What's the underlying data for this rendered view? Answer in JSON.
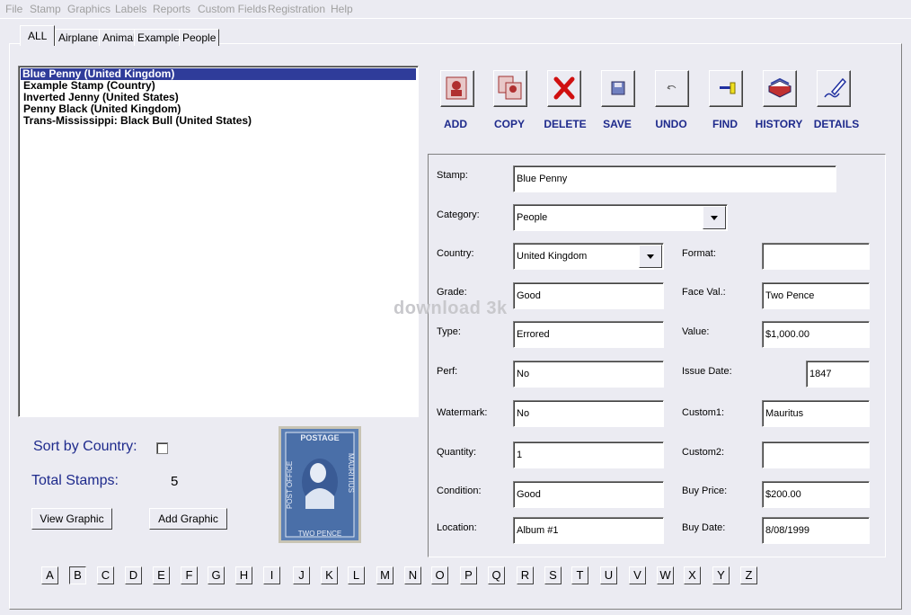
{
  "menu": [
    "File",
    "Stamp",
    "Graphics",
    "Labels",
    "Reports",
    "Custom Fields",
    "Registration",
    "Help"
  ],
  "tabs": [
    "ALL",
    "Airplane",
    "Animal",
    "Example",
    "People"
  ],
  "stamp_list": [
    "Blue Penny (United Kingdom)",
    "Example Stamp (Country)",
    "Inverted Jenny (United States)",
    "Penny Black (United Kingdom)",
    "Trans-Mississippi: Black Bull (United States)"
  ],
  "toolbar": {
    "add": "ADD",
    "copy": "COPY",
    "delete": "DELETE",
    "save": "SAVE",
    "undo": "UNDO",
    "find": "FIND",
    "history": "HISTORY",
    "details": "DETAILS"
  },
  "form": {
    "stamp": {
      "label": "Stamp:",
      "value": "Blue Penny"
    },
    "category": {
      "label": "Category:",
      "value": "People"
    },
    "country": {
      "label": "Country:",
      "value": "United Kingdom"
    },
    "format": {
      "label": "Format:",
      "value": ""
    },
    "grade": {
      "label": "Grade:",
      "value": "Good"
    },
    "face_val": {
      "label": "Face Val.:",
      "value": "Two Pence"
    },
    "type": {
      "label": "Type:",
      "value": "Errored"
    },
    "value": {
      "label": "Value:",
      "value": "$1,000.00"
    },
    "perf": {
      "label": "Perf:",
      "value": "No"
    },
    "issue_date": {
      "label": "Issue Date:",
      "value": "1847"
    },
    "watermark": {
      "label": "Watermark:",
      "value": "No"
    },
    "custom1": {
      "label": "Custom1:",
      "value": "Mauritus"
    },
    "quantity": {
      "label": "Quantity:",
      "value": "1"
    },
    "custom2": {
      "label": "Custom2:",
      "value": ""
    },
    "condition": {
      "label": "Condition:",
      "value": "Good"
    },
    "buy_price": {
      "label": "Buy Price:",
      "value": "$200.00"
    },
    "location": {
      "label": "Location:",
      "value": "Album #1"
    },
    "buy_date": {
      "label": "Buy Date:",
      "value": "8/08/1999"
    }
  },
  "sort_by_country": {
    "label": "Sort by Country:",
    "checked": false
  },
  "total_stamps": {
    "label": "Total Stamps:",
    "value": "5"
  },
  "buttons": {
    "view_graphic": "View Graphic",
    "add_graphic": "Add Graphic"
  },
  "stamp_image": {
    "top_text": "POSTAGE",
    "bottom_text": "TWO PENCE",
    "left_text": "POST OFFICE",
    "right_text": "MAURITIUS"
  },
  "letters": [
    "A",
    "B",
    "C",
    "D",
    "E",
    "F",
    "G",
    "H",
    "I",
    "J",
    "K",
    "L",
    "M",
    "N",
    "O",
    "P",
    "Q",
    "R",
    "S",
    "T",
    "U",
    "V",
    "W",
    "X",
    "Y",
    "Z"
  ],
  "watermark_text": "download 3k"
}
